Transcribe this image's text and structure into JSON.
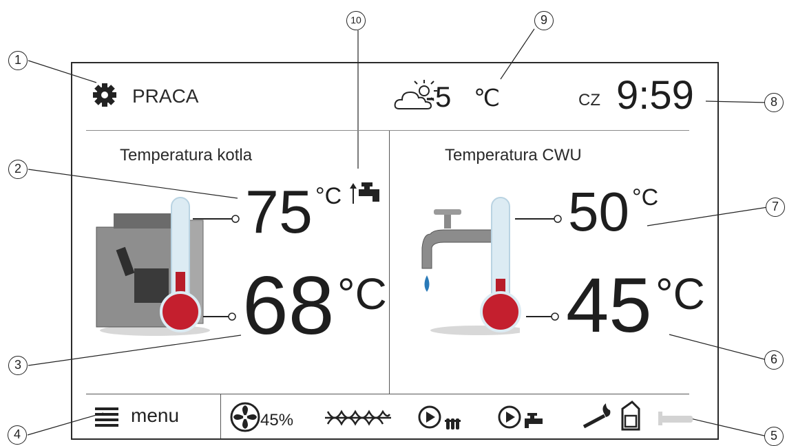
{
  "header": {
    "status": "PRACA",
    "weather_temp": "-5",
    "weather_unit": "℃",
    "day": "CZ",
    "time": "9:59"
  },
  "boiler": {
    "title": "Temperatura kotla",
    "set_temp": "75",
    "set_unit": "°C",
    "actual_temp": "68",
    "actual_unit": "°C"
  },
  "dhw": {
    "title": "Temperatura CWU",
    "set_temp": "50",
    "set_unit": "°C",
    "actual_temp": "45",
    "actual_unit": "°C"
  },
  "footer": {
    "menu_label": "menu",
    "fan_percent": "45%"
  },
  "callouts": [
    "1",
    "2",
    "3",
    "4",
    "5",
    "6",
    "7",
    "8",
    "9",
    "10"
  ],
  "icons": [
    "gear-icon",
    "weather-icon",
    "dhw-priority-icon",
    "menu-icon",
    "fan-icon",
    "feeder-screw-icon",
    "pump-heating-icon",
    "pump-dhw-icon",
    "igniter-icon",
    "fuel-tank-icon",
    "thermostat-icon"
  ]
}
